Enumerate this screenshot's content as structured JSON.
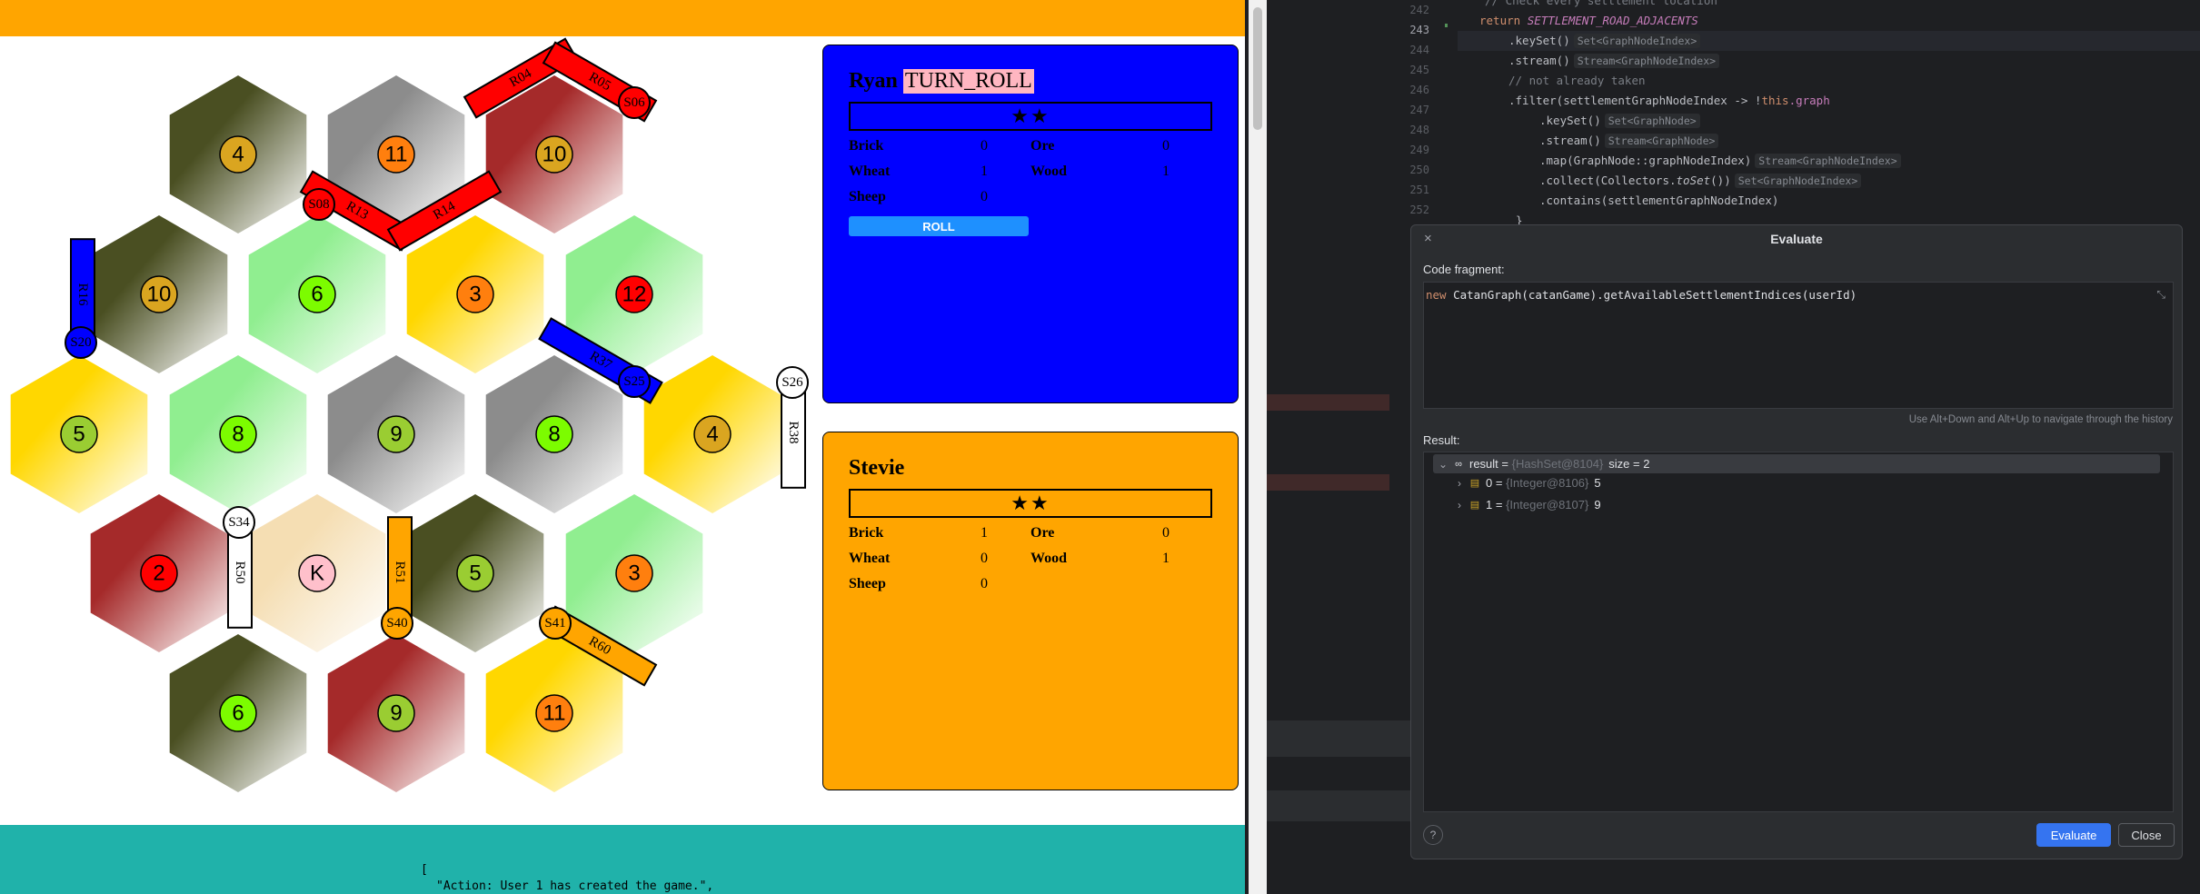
{
  "board": {
    "tiles": [
      {
        "number": "4"
      },
      {
        "number": "11"
      },
      {
        "number": "10"
      },
      {
        "number": "10"
      },
      {
        "number": "6"
      },
      {
        "number": "3"
      },
      {
        "number": "12"
      },
      {
        "number": "5"
      },
      {
        "number": "8"
      },
      {
        "number": "9"
      },
      {
        "number": "8"
      },
      {
        "number": "4"
      },
      {
        "number": "2"
      },
      {
        "number": "K"
      },
      {
        "number": "5"
      },
      {
        "number": "3"
      },
      {
        "number": "6"
      },
      {
        "number": "9"
      },
      {
        "number": "11"
      }
    ],
    "roads": [
      {
        "label": "R04",
        "color": "#ff0000"
      },
      {
        "label": "R05",
        "color": "#ff0000"
      },
      {
        "label": "R13",
        "color": "#ff0000"
      },
      {
        "label": "R14",
        "color": "#ff0000"
      },
      {
        "label": "R16",
        "color": "#0000ff"
      },
      {
        "label": "R37",
        "color": "#0000ff"
      },
      {
        "label": "R38",
        "color": "#ffffff"
      },
      {
        "label": "R50",
        "color": "#ffffff"
      },
      {
        "label": "R51",
        "color": "#ffa500"
      },
      {
        "label": "R60",
        "color": "#ffa500"
      }
    ],
    "settlements": [
      {
        "label": "S06",
        "color": "#ff0000"
      },
      {
        "label": "S08",
        "color": "#ff0000"
      },
      {
        "label": "S20",
        "color": "#0000ff"
      },
      {
        "label": "S25",
        "color": "#0000ff"
      },
      {
        "label": "S26",
        "color": "#ffffff"
      },
      {
        "label": "S34",
        "color": "#ffffff"
      },
      {
        "label": "S40",
        "color": "#ffa500"
      },
      {
        "label": "S41",
        "color": "#ffa500"
      }
    ]
  },
  "players": [
    {
      "name": "Ryan",
      "status": "TURN_ROLL",
      "stars": "★★",
      "resources": {
        "brick": "0",
        "ore": "0",
        "wheat": "1",
        "wood": "1",
        "sheep": "0"
      },
      "roll_label": "ROLL"
    },
    {
      "name": "Stevie",
      "stars": "★★",
      "resources": {
        "brick": "1",
        "ore": "0",
        "wheat": "0",
        "wood": "1",
        "sheep": "0"
      }
    }
  ],
  "resource_labels": {
    "brick": "Brick",
    "ore": "Ore",
    "wheat": "Wheat",
    "wood": "Wood",
    "sheep": "Sheep"
  },
  "log": {
    "open": "[",
    "first_entry": "\"Action: User 1 has created the game.\","
  },
  "ide": {
    "line_numbers": [
      "242",
      "243",
      "244",
      "245",
      "246",
      "247",
      "248",
      "249",
      "250",
      "251",
      "252"
    ],
    "comment_partial": "// Check every settlement location",
    "return_kw": "return",
    "return_const": "SETTLEMENT_ROAD_ADJACENTS",
    "keyset_call": ".keySet()",
    "keyset_hint": "Set<GraphNodeIndex>",
    "stream_call": ".stream()",
    "stream_hint": "Stream<GraphNodeIndex>",
    "comment_not_taken": "// not already taken",
    "filter_prefix": ".filter(settlementGraphNodeIndex -> !",
    "filter_this": "this",
    "filter_graph": ".graph",
    "keyset2_hint": "Set<GraphNode>",
    "stream2_hint": "Stream<GraphNode>",
    "map_call": ".map(GraphNode::graphNodeIndex)",
    "map_hint": "Stream<GraphNodeIndex>",
    "collect_prefix": ".collect(Collectors.",
    "collect_toset": "toSet",
    "collect_suffix": "())",
    "collect_hint": "Set<GraphNodeIndex>",
    "contains_call": ".contains(settlementGraphNodeIndex)",
    "closing_brace": "}"
  },
  "evaluate": {
    "title": "Evaluate",
    "close_x": "×",
    "code_fragment_label": "Code fragment:",
    "fragment_kw": "new",
    "fragment_rest": " CatanGraph(catanGame).getAvailableSettlementIndices(userId)",
    "history_hint": "Use Alt+Down and Alt+Up to navigate through the history",
    "result_label": "Result:",
    "result_rows": [
      {
        "arrow": "⌄",
        "name": "result",
        "eq": " = ",
        "ref": "{HashSet@8104}",
        "value": "size = 2"
      },
      {
        "arrow": "›",
        "name": "0",
        "eq": " = ",
        "ref": "{Integer@8106}",
        "value": "5"
      },
      {
        "arrow": "›",
        "name": "1",
        "eq": " = ",
        "ref": "{Integer@8107}",
        "value": "9"
      }
    ],
    "help_label": "?",
    "evaluate_button": "Evaluate",
    "close_button": "Close"
  }
}
